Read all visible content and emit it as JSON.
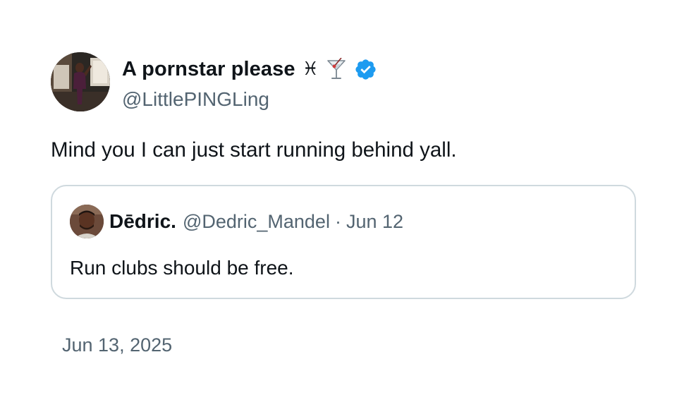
{
  "author": {
    "display_name": "A pornstar please",
    "name_emojis": [
      "♓",
      "🍸"
    ],
    "verified": true,
    "verified_color": "#1d9bf0",
    "handle": "@LittlePINGLing",
    "avatar_icon": "profile-photo"
  },
  "tweet": {
    "text": "Mind you I can just start running behind yall.",
    "timestamp": "Jun 13, 2025"
  },
  "quoted_tweet": {
    "display_name": "Dēdric.",
    "handle": "@Dedric_Mandel",
    "separator": "·",
    "date": "Jun 12",
    "text": "Run clubs should be free.",
    "avatar_icon": "profile-photo"
  },
  "colors": {
    "text_primary": "#0f1419",
    "text_secondary": "#536471",
    "border": "#cfd9de",
    "background": "#ffffff"
  }
}
